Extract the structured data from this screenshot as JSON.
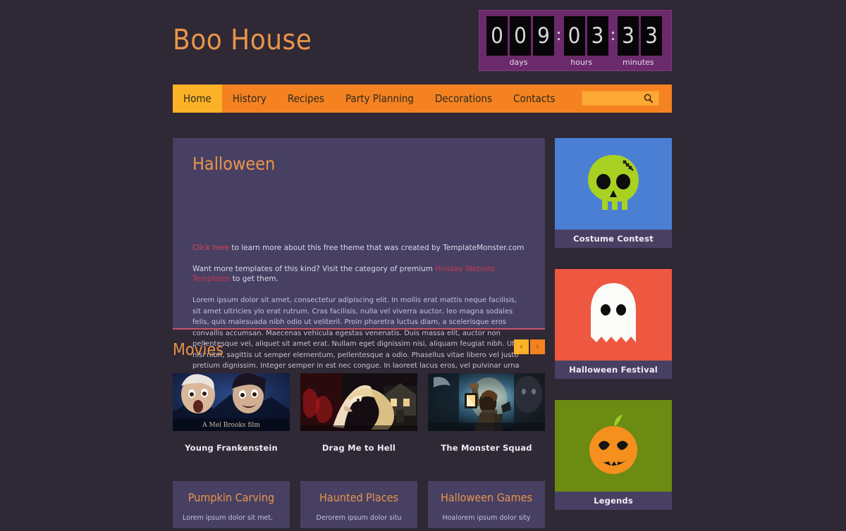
{
  "site": {
    "brand": "Boo House"
  },
  "countdown": {
    "days_digits": [
      "0",
      "0",
      "9"
    ],
    "hours_digits": [
      "0",
      "3"
    ],
    "minutes_digits": [
      "3",
      "3"
    ],
    "label_days": "days",
    "label_hours": "hours",
    "label_minutes": "minutes"
  },
  "nav": {
    "items": [
      {
        "label": "Home",
        "active": true
      },
      {
        "label": "History",
        "active": false
      },
      {
        "label": "Recipes",
        "active": false
      },
      {
        "label": "Party Planning",
        "active": false
      },
      {
        "label": "Decorations",
        "active": false
      },
      {
        "label": "Contacts",
        "active": false
      }
    ],
    "search": {
      "value": "",
      "placeholder": "",
      "icon": "search-icon"
    }
  },
  "main": {
    "heading": "Halloween",
    "promo_line1_link": "Click here",
    "promo_line1_rest": " to learn more about this free theme that was created by TemplateMonster.com",
    "promo_line2_pre": "Want more templates of this kind? Visit the category of premium ",
    "promo_line2_link": "Holiday Website Templates",
    "promo_line2_post": " to get them.",
    "body": "Lorem ipsum dolor sit amet, consectetur adipiscing elit. In mollis erat mattis neque facilisis, sit amet ultricies ylo erat rutrum. Cras facilisis, nulla vel viverra auctor, leo magna sodales felis, quis malesuada nibh odio ut veliteril. Proin pharetra luctus diam, a scelerisque eros convallis accumsan. Maecenas vehicula egestas venenatis. Duis massa elit, auctor non pellentesque vel, aliquet sit amet erat. Nullam eget dignissim nisi, aliquam feugiat nibh. Ut nisi nibh, sagittis ut semper elementum, pellentesque a odio. Phasellus vitae libero vel justo pretium dignissim. Integer semper in est nec congue. In laoreet lacus eros, vel pulvinar urna ultricies ut."
  },
  "movies": {
    "heading": "Movies",
    "prev_label": "‹",
    "next_label": "›",
    "items": [
      {
        "title": "Young Frankenstein",
        "art": "young-frankenstein"
      },
      {
        "title": "Drag Me to Hell",
        "art": "drag-me-to-hell"
      },
      {
        "title": "The Monster Squad",
        "art": "the-monster-squad"
      }
    ]
  },
  "cards": [
    {
      "title": "Pumpkin Carving",
      "text": "Lorem ipsum dolor sit met,"
    },
    {
      "title": "Haunted Places",
      "text": "Derorem ipsum dolor situ"
    },
    {
      "title": "Halloween Games",
      "text": "Hoalorem ipsum dolor sity"
    }
  ],
  "sidebar": {
    "blocks": [
      {
        "caption": "Costume Contest",
        "icon": "skull-icon",
        "bg": "#4a7fd4"
      },
      {
        "caption": "Halloween Festival",
        "icon": "ghost-icon",
        "bg": "#ef5840"
      },
      {
        "caption": "Legends",
        "icon": "pumpkin-icon",
        "bg": "#6b8b12"
      }
    ]
  },
  "colors": {
    "page_bg": "#2f2835",
    "panel": "#474063",
    "accent_orange": "#e8954a",
    "nav_orange": "#f58220",
    "nav_active": "#fcb227",
    "countdown_frame": "#6b2a6b",
    "link_red": "#e0455a"
  }
}
